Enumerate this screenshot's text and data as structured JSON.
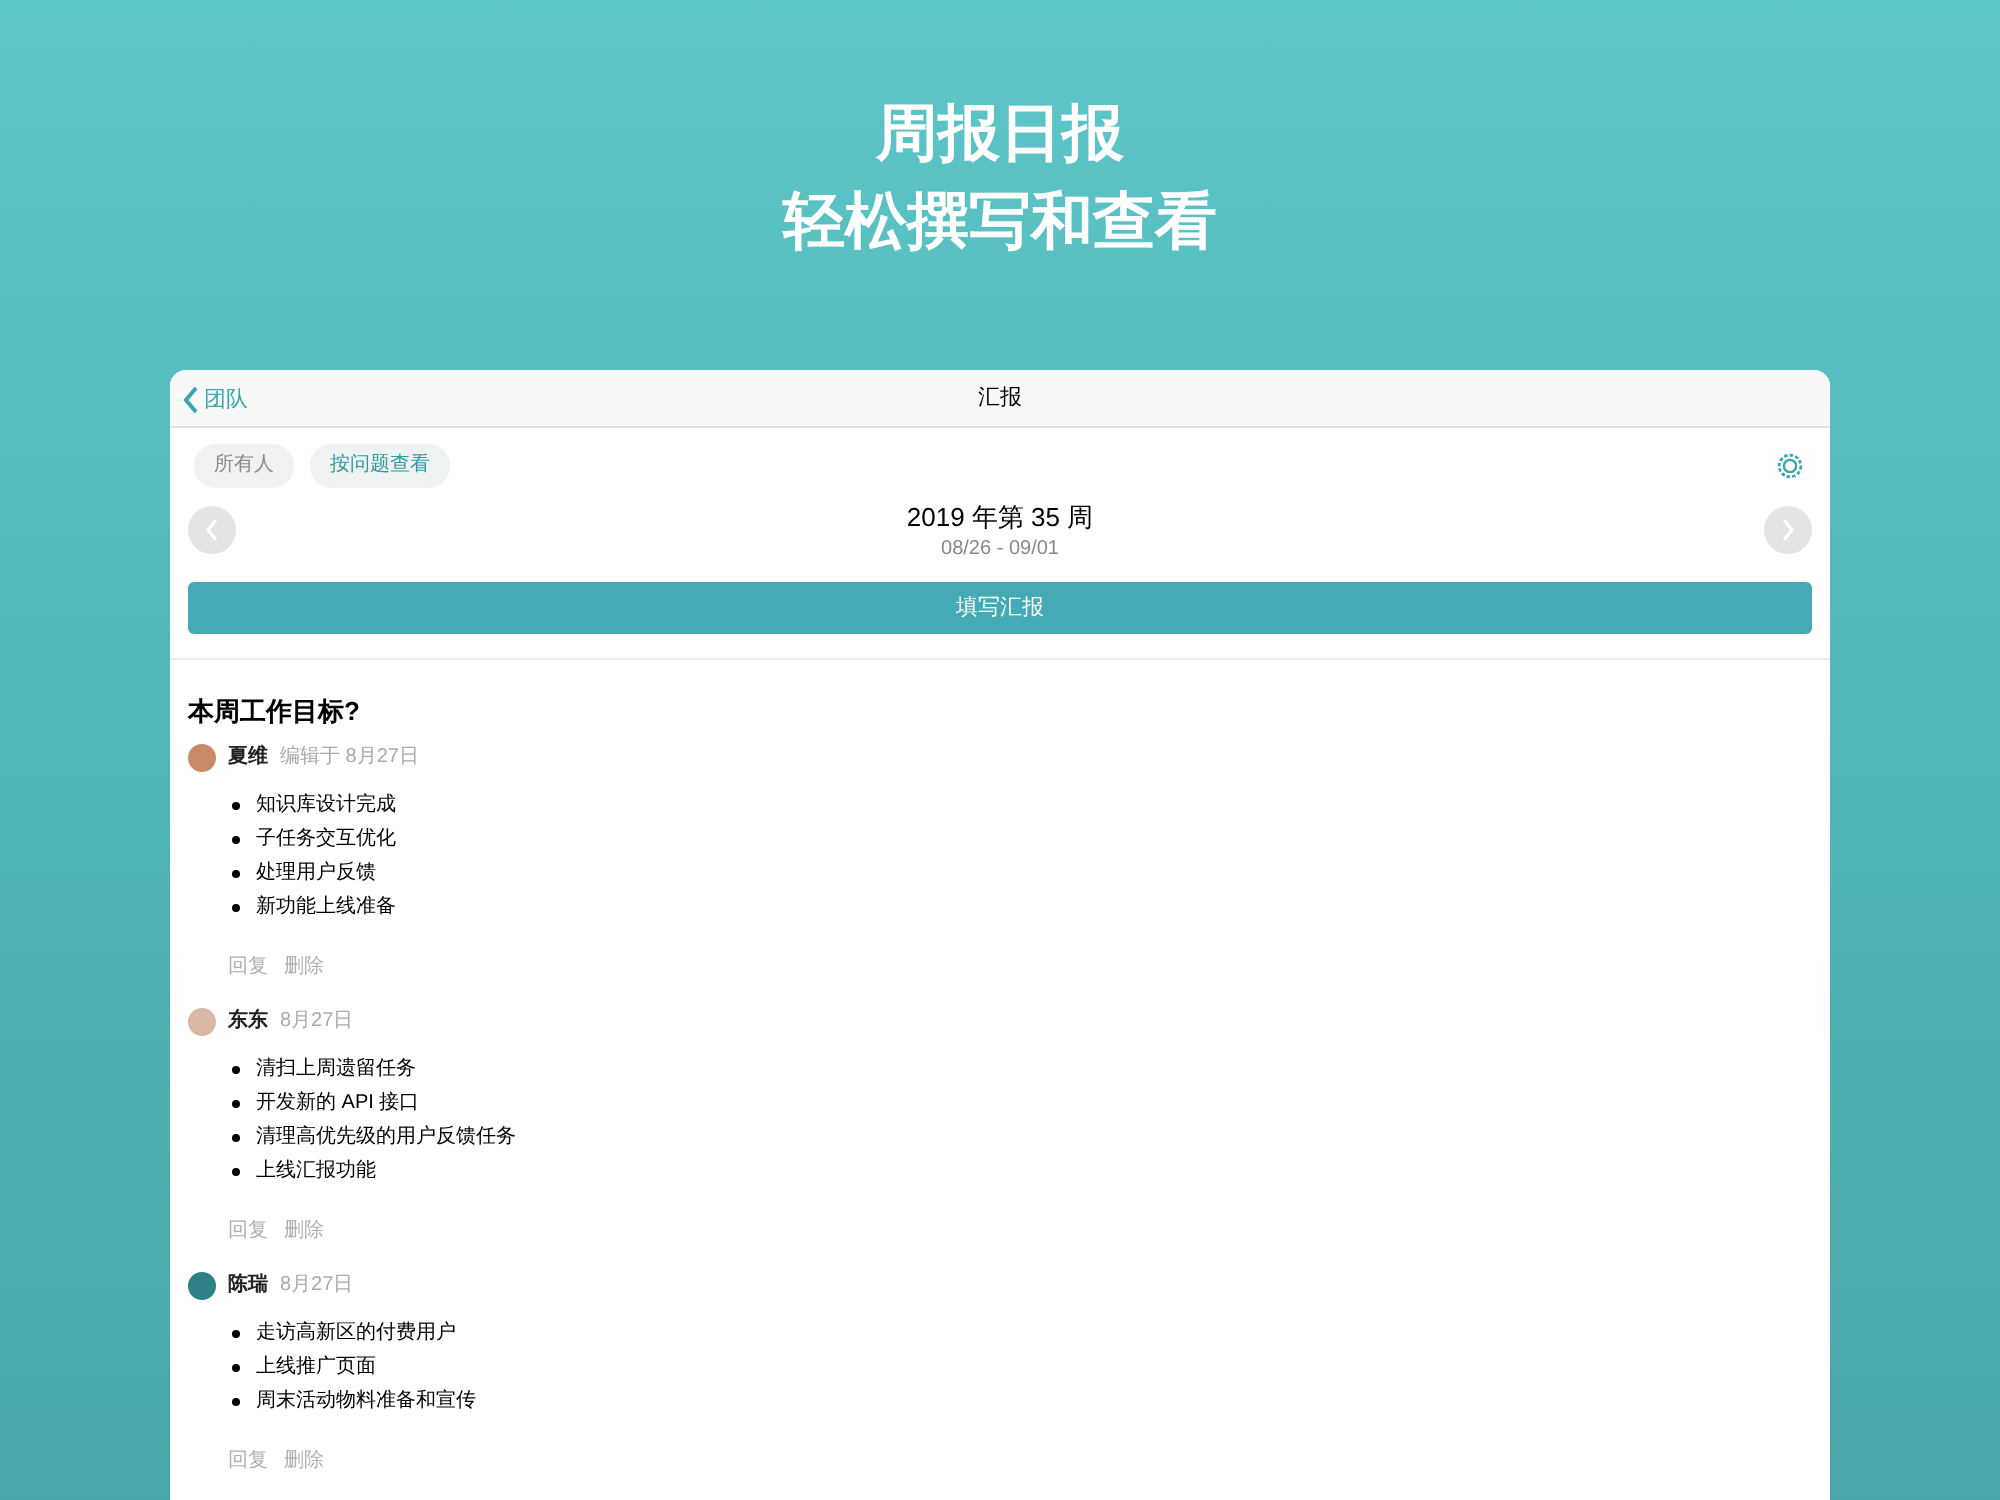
{
  "headline": [
    "周报日报",
    "轻松撰写和查看"
  ],
  "nav": {
    "back": "团队",
    "title": "汇报"
  },
  "filters": [
    {
      "label": "所有人",
      "selected": false
    },
    {
      "label": "按问题查看",
      "selected": true
    }
  ],
  "week": {
    "title": "2019 年第 35 周",
    "range": "08/26 - 09/01"
  },
  "write_button": "填写汇报",
  "question": "本周工作目标?",
  "entries": [
    {
      "author": "夏维",
      "meta": "编辑于 8月27日",
      "color": "#c98a6a",
      "items": [
        "知识库设计完成",
        "子任务交互优化",
        "处理用户反馈",
        "新功能上线准备"
      ],
      "actions": [
        "回复",
        "删除"
      ]
    },
    {
      "author": "东东",
      "meta": "8月27日",
      "color": "#d9b8a8",
      "items": [
        "清扫上周遗留任务",
        "开发新的 API 接口",
        "清理高优先级的用户反馈任务",
        "上线汇报功能"
      ],
      "actions": [
        "回复",
        "删除"
      ]
    },
    {
      "author": "陈瑞",
      "meta": "8月27日",
      "color": "#2f7f86",
      "items": [
        "走访高新区的付费用户",
        "上线推广页面",
        "周末活动物料准备和宣传"
      ],
      "actions": [
        "回复",
        "删除"
      ]
    }
  ]
}
